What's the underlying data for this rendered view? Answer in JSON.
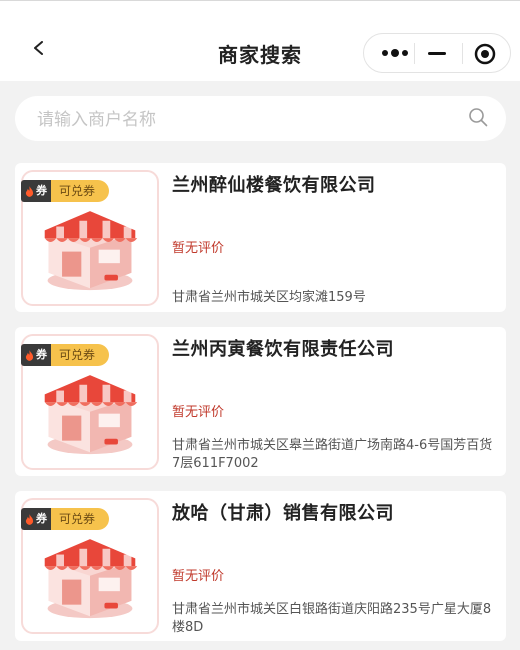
{
  "nav": {
    "title": "商家搜索"
  },
  "search": {
    "placeholder": "请输入商户名称",
    "value": ""
  },
  "merchants": [
    {
      "badge_hot": "券",
      "badge_label": "可兑券",
      "name": "兰州醉仙楼餐饮有限公司",
      "rating": "暂无评价",
      "address": "甘肃省兰州市城关区均家滩159号"
    },
    {
      "badge_hot": "券",
      "badge_label": "可兑券",
      "name": "兰州丙寅餐饮有限责任公司",
      "rating": "暂无评价",
      "address": "甘肃省兰州市城关区皋兰路街道广场南路4-6号国芳百货7层611F7002"
    },
    {
      "badge_hot": "券",
      "badge_label": "可兑券",
      "name": "放哈（甘肃）销售有限公司",
      "rating": "暂无评价",
      "address": "甘肃省兰州市城关区白银路街道庆阳路235号广星大厦8楼8D"
    }
  ],
  "icons": {
    "back": "chevron-left-icon",
    "more": "more-dots-icon",
    "minimize": "minimize-icon",
    "close": "target-circle-icon",
    "search": "search-icon",
    "flame": "flame-icon",
    "shop": "storefront-illustration"
  },
  "colors": {
    "rating": "#c0392b",
    "badge_yellow": "#f6c24c",
    "badge_dark": "#3a3a3a",
    "thumb_border": "#f7dbd9"
  }
}
